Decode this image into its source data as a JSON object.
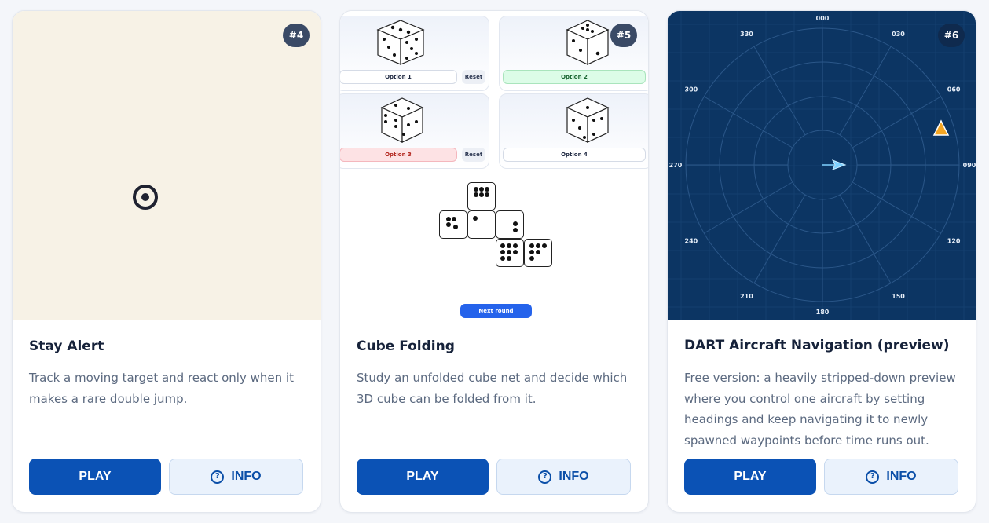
{
  "cards": [
    {
      "badge": "#4",
      "title": "Stay Alert",
      "description": "Track a moving target and react only when it makes a rare double jump.",
      "play_label": "PLAY",
      "info_label": "INFO"
    },
    {
      "badge": "#5",
      "title": "Cube Folding",
      "description": "Study an unfolded cube net and decide which 3D cube can be folded from it.",
      "play_label": "PLAY",
      "info_label": "INFO",
      "options": [
        "Option 1",
        "Option 2",
        "Option 3",
        "Option 4"
      ],
      "reset_label": "Reset",
      "next_round_label": "Next round",
      "colors": {
        "correct": "#dcfce7",
        "wrong": "#fde2e4"
      }
    },
    {
      "badge": "#6",
      "title": "DART Aircraft Navigation (preview)",
      "description": "Free version: a heavily stripped-down preview where you control one aircraft by setting headings and keep navigating it to newly spawned waypoints before time runs out.",
      "play_label": "PLAY",
      "info_label": "INFO",
      "compass_labels": [
        "000",
        "030",
        "060",
        "090",
        "120",
        "150",
        "180",
        "210",
        "240",
        "270",
        "300",
        "330"
      ]
    }
  ],
  "icons": {
    "info": "question-circle-icon",
    "target": "target-icon",
    "aircraft": "aircraft-arrow-icon",
    "waypoint": "waypoint-triangle-icon"
  },
  "colors": {
    "primary": "#0b52b5",
    "badge": "#3a4a66",
    "radar": "#0c3563",
    "alert_bg": "#f7f2e6"
  }
}
